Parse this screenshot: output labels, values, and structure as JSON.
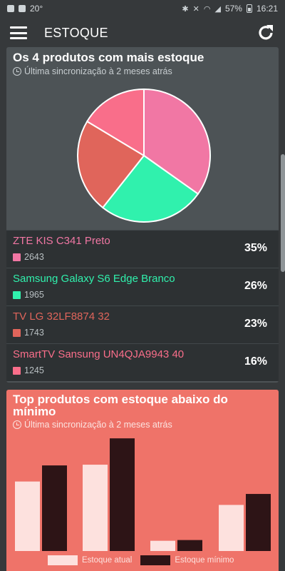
{
  "status_bar": {
    "temperature": "20°",
    "battery": "57%",
    "time": "16:21"
  },
  "app_bar": {
    "title": "ESTOQUE"
  },
  "card_top": {
    "title": "Os 4 produtos com mais estoque",
    "subtitle": "Última sincronização à 2 meses atrás",
    "items": [
      {
        "name": "ZTE KIS C341 Preto",
        "count": "2643",
        "percent": "35%",
        "color": "#f177a4"
      },
      {
        "name": "Samsung Galaxy S6 Edge Branco",
        "count": "1965",
        "percent": "26%",
        "color": "#30f1ad"
      },
      {
        "name": "TV LG 32LF8874 32",
        "count": "1743",
        "percent": "23%",
        "color": "#e0655b"
      },
      {
        "name": "SmartTV Sansung UN4QJA9943 40",
        "count": "1245",
        "percent": "16%",
        "color": "#f96e8a"
      }
    ]
  },
  "card_bottom": {
    "title": "Top produtos com estoque abaixo do mínimo",
    "subtitle": "Última sincronização à 2 meses atrás",
    "legend": [
      {
        "label": "Estoque atual",
        "color": "#fde1de"
      },
      {
        "label": "Estoque mínimo",
        "color": "#2d1416"
      }
    ]
  },
  "chart_data": [
    {
      "type": "pie",
      "title": "Os 4 produtos com mais estoque",
      "labels": [
        "ZTE KIS C341 Preto",
        "Samsung Galaxy S6 Edge Branco",
        "TV LG 32LF8874 32",
        "SmartTV Sansung UN4QJA9943 40"
      ],
      "values": [
        2643,
        1965,
        1743,
        1245
      ],
      "colors": [
        "#f177a4",
        "#30f1ad",
        "#e0655b",
        "#f96e8a"
      ]
    },
    {
      "type": "bar",
      "title": "Top produtos com estoque abaixo do mínimo",
      "categories": [
        "",
        "",
        "",
        ""
      ],
      "ylim": [
        0,
        160
      ],
      "series": [
        {
          "name": "Estoque atual",
          "values": [
            95,
            118,
            14,
            63
          ],
          "color": "#fde1de"
        },
        {
          "name": "Estoque mínimo",
          "values": [
            117,
            154,
            15,
            78
          ],
          "color": "#2d1416"
        }
      ]
    }
  ]
}
